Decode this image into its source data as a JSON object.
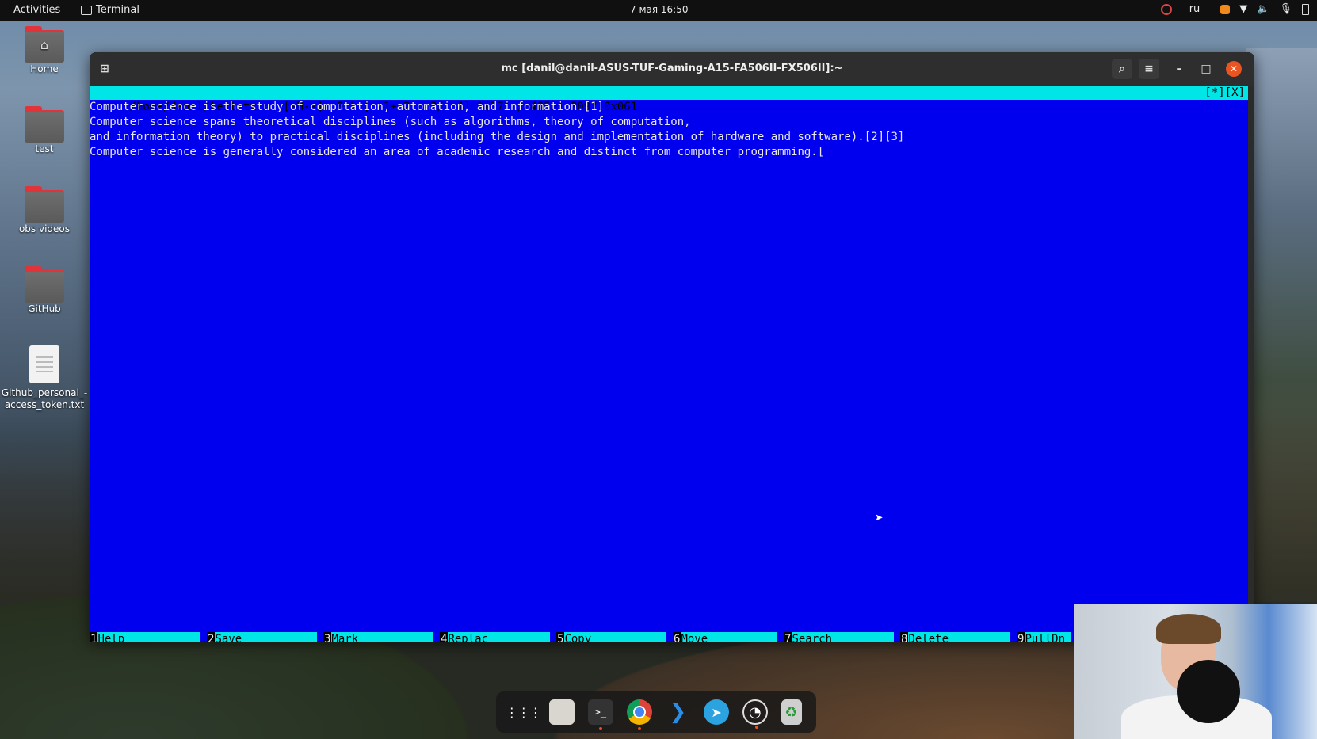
{
  "topbar": {
    "activities": "Activities",
    "app_name": "Terminal",
    "clock": "7 мая 16:50",
    "keyboard_layout": "ru"
  },
  "desktop": {
    "items": [
      {
        "label": "Home",
        "icon": "home-folder-icon"
      },
      {
        "label": "test",
        "icon": "folder-icon"
      },
      {
        "label": "obs videos",
        "icon": "folder-icon"
      },
      {
        "label": "GitHub",
        "icon": "folder-icon"
      },
      {
        "label": "Github_personal_-\naccess_token.txt",
        "icon": "text-file-icon"
      }
    ]
  },
  "window": {
    "title": "mc [danil@danil-ASUS-TUF-Gaming-A15-FA506II-FX506II]:~"
  },
  "editor": {
    "status_left": "/home/danil/text.txt   [-M--]  0 L:[  1+ 2   3/  4] *(171 / 405b) 0097 0x061",
    "status_right": "[*][X]",
    "lines": [
      "Computer science is the study of computation, automation, and information.[1]",
      "Computer science spans theoretical disciplines (such as algorithms, theory of computation,",
      "and information theory) to practical disciplines (including the design and implementation of hardware and software).[2][3]",
      "Computer science is generally considered an area of academic research and distinct from computer programming.["
    ],
    "fkeys": [
      {
        "num": "1",
        "label": "Help"
      },
      {
        "num": "2",
        "label": "Save"
      },
      {
        "num": "3",
        "label": "Mark"
      },
      {
        "num": "4",
        "label": "Replac"
      },
      {
        "num": "5",
        "label": "Copy"
      },
      {
        "num": "6",
        "label": "Move"
      },
      {
        "num": "7",
        "label": "Search"
      },
      {
        "num": "8",
        "label": "Delete"
      },
      {
        "num": "9",
        "label": "PullDn"
      }
    ]
  },
  "dock": {
    "items": [
      "app-grid-icon",
      "files-icon",
      "terminal-icon",
      "chrome-icon",
      "vscode-icon",
      "telegram-icon",
      "obs-icon",
      "trash-icon"
    ]
  },
  "colors": {
    "editor_bg": "#0000ee",
    "status_bg": "#00e5e5",
    "accent": "#e95420"
  }
}
